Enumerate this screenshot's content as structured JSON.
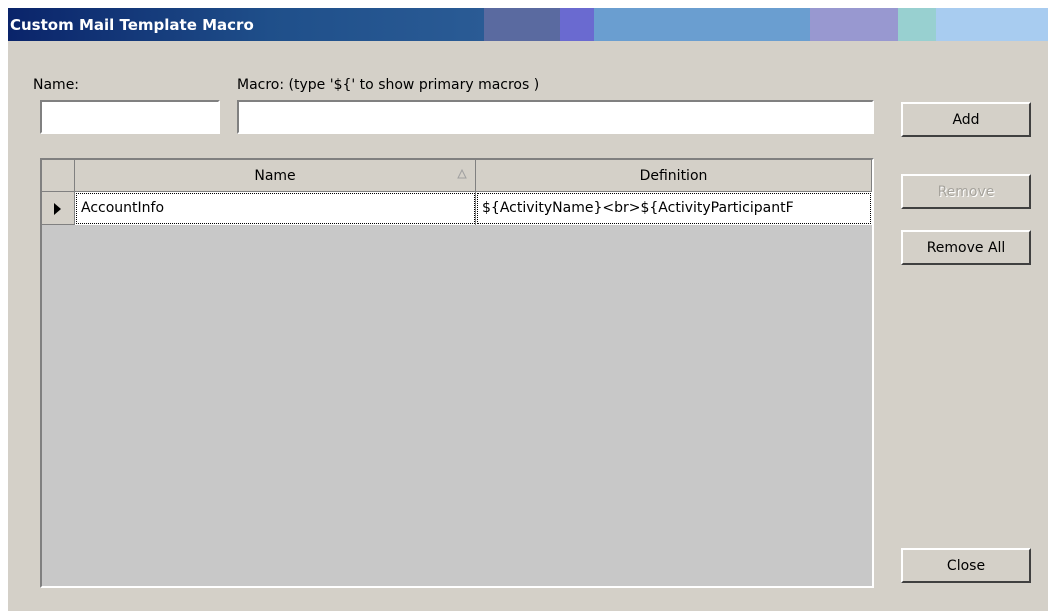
{
  "window": {
    "title": "Custom Mail Template Macro"
  },
  "form": {
    "name_label": "Name:",
    "macro_label": "Macro: (type '${' to show primary macros )",
    "name_value": "",
    "macro_value": ""
  },
  "buttons": {
    "add": "Add",
    "remove": "Remove",
    "remove_all": "Remove All",
    "close": "Close"
  },
  "grid": {
    "columns": [
      "Name",
      "Definition"
    ],
    "sort_indicator_icon": "sort-ascending-icon",
    "row_indicator_icon": "current-row-arrow-icon",
    "rows": [
      {
        "name": "AccountInfo",
        "definition": "${ActivityName}<br>${ActivityParticipantF"
      }
    ]
  },
  "colors": {
    "dialog_bg": "#d4d0c8",
    "grid_bg": "#c8c8c8",
    "titlebar_dark": "#1f4f8a",
    "titlebar_light": "#a8ccf0"
  }
}
